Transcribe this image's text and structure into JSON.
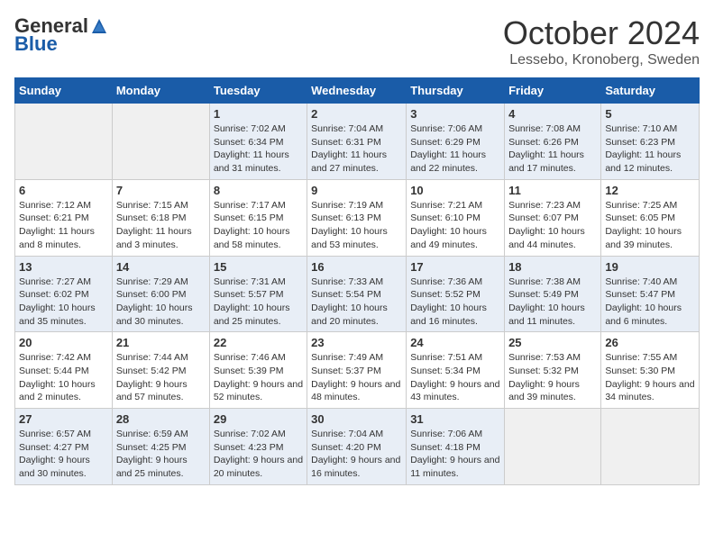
{
  "header": {
    "logo_general": "General",
    "logo_blue": "Blue",
    "month_title": "October 2024",
    "location": "Lessebo, Kronoberg, Sweden"
  },
  "weekdays": [
    "Sunday",
    "Monday",
    "Tuesday",
    "Wednesday",
    "Thursday",
    "Friday",
    "Saturday"
  ],
  "weeks": [
    [
      {
        "day": "",
        "sunrise": "",
        "sunset": "",
        "daylight": ""
      },
      {
        "day": "",
        "sunrise": "",
        "sunset": "",
        "daylight": ""
      },
      {
        "day": "1",
        "sunrise": "Sunrise: 7:02 AM",
        "sunset": "Sunset: 6:34 PM",
        "daylight": "Daylight: 11 hours and 31 minutes."
      },
      {
        "day": "2",
        "sunrise": "Sunrise: 7:04 AM",
        "sunset": "Sunset: 6:31 PM",
        "daylight": "Daylight: 11 hours and 27 minutes."
      },
      {
        "day": "3",
        "sunrise": "Sunrise: 7:06 AM",
        "sunset": "Sunset: 6:29 PM",
        "daylight": "Daylight: 11 hours and 22 minutes."
      },
      {
        "day": "4",
        "sunrise": "Sunrise: 7:08 AM",
        "sunset": "Sunset: 6:26 PM",
        "daylight": "Daylight: 11 hours and 17 minutes."
      },
      {
        "day": "5",
        "sunrise": "Sunrise: 7:10 AM",
        "sunset": "Sunset: 6:23 PM",
        "daylight": "Daylight: 11 hours and 12 minutes."
      }
    ],
    [
      {
        "day": "6",
        "sunrise": "Sunrise: 7:12 AM",
        "sunset": "Sunset: 6:21 PM",
        "daylight": "Daylight: 11 hours and 8 minutes."
      },
      {
        "day": "7",
        "sunrise": "Sunrise: 7:15 AM",
        "sunset": "Sunset: 6:18 PM",
        "daylight": "Daylight: 11 hours and 3 minutes."
      },
      {
        "day": "8",
        "sunrise": "Sunrise: 7:17 AM",
        "sunset": "Sunset: 6:15 PM",
        "daylight": "Daylight: 10 hours and 58 minutes."
      },
      {
        "day": "9",
        "sunrise": "Sunrise: 7:19 AM",
        "sunset": "Sunset: 6:13 PM",
        "daylight": "Daylight: 10 hours and 53 minutes."
      },
      {
        "day": "10",
        "sunrise": "Sunrise: 7:21 AM",
        "sunset": "Sunset: 6:10 PM",
        "daylight": "Daylight: 10 hours and 49 minutes."
      },
      {
        "day": "11",
        "sunrise": "Sunrise: 7:23 AM",
        "sunset": "Sunset: 6:07 PM",
        "daylight": "Daylight: 10 hours and 44 minutes."
      },
      {
        "day": "12",
        "sunrise": "Sunrise: 7:25 AM",
        "sunset": "Sunset: 6:05 PM",
        "daylight": "Daylight: 10 hours and 39 minutes."
      }
    ],
    [
      {
        "day": "13",
        "sunrise": "Sunrise: 7:27 AM",
        "sunset": "Sunset: 6:02 PM",
        "daylight": "Daylight: 10 hours and 35 minutes."
      },
      {
        "day": "14",
        "sunrise": "Sunrise: 7:29 AM",
        "sunset": "Sunset: 6:00 PM",
        "daylight": "Daylight: 10 hours and 30 minutes."
      },
      {
        "day": "15",
        "sunrise": "Sunrise: 7:31 AM",
        "sunset": "Sunset: 5:57 PM",
        "daylight": "Daylight: 10 hours and 25 minutes."
      },
      {
        "day": "16",
        "sunrise": "Sunrise: 7:33 AM",
        "sunset": "Sunset: 5:54 PM",
        "daylight": "Daylight: 10 hours and 20 minutes."
      },
      {
        "day": "17",
        "sunrise": "Sunrise: 7:36 AM",
        "sunset": "Sunset: 5:52 PM",
        "daylight": "Daylight: 10 hours and 16 minutes."
      },
      {
        "day": "18",
        "sunrise": "Sunrise: 7:38 AM",
        "sunset": "Sunset: 5:49 PM",
        "daylight": "Daylight: 10 hours and 11 minutes."
      },
      {
        "day": "19",
        "sunrise": "Sunrise: 7:40 AM",
        "sunset": "Sunset: 5:47 PM",
        "daylight": "Daylight: 10 hours and 6 minutes."
      }
    ],
    [
      {
        "day": "20",
        "sunrise": "Sunrise: 7:42 AM",
        "sunset": "Sunset: 5:44 PM",
        "daylight": "Daylight: 10 hours and 2 minutes."
      },
      {
        "day": "21",
        "sunrise": "Sunrise: 7:44 AM",
        "sunset": "Sunset: 5:42 PM",
        "daylight": "Daylight: 9 hours and 57 minutes."
      },
      {
        "day": "22",
        "sunrise": "Sunrise: 7:46 AM",
        "sunset": "Sunset: 5:39 PM",
        "daylight": "Daylight: 9 hours and 52 minutes."
      },
      {
        "day": "23",
        "sunrise": "Sunrise: 7:49 AM",
        "sunset": "Sunset: 5:37 PM",
        "daylight": "Daylight: 9 hours and 48 minutes."
      },
      {
        "day": "24",
        "sunrise": "Sunrise: 7:51 AM",
        "sunset": "Sunset: 5:34 PM",
        "daylight": "Daylight: 9 hours and 43 minutes."
      },
      {
        "day": "25",
        "sunrise": "Sunrise: 7:53 AM",
        "sunset": "Sunset: 5:32 PM",
        "daylight": "Daylight: 9 hours and 39 minutes."
      },
      {
        "day": "26",
        "sunrise": "Sunrise: 7:55 AM",
        "sunset": "Sunset: 5:30 PM",
        "daylight": "Daylight: 9 hours and 34 minutes."
      }
    ],
    [
      {
        "day": "27",
        "sunrise": "Sunrise: 6:57 AM",
        "sunset": "Sunset: 4:27 PM",
        "daylight": "Daylight: 9 hours and 30 minutes."
      },
      {
        "day": "28",
        "sunrise": "Sunrise: 6:59 AM",
        "sunset": "Sunset: 4:25 PM",
        "daylight": "Daylight: 9 hours and 25 minutes."
      },
      {
        "day": "29",
        "sunrise": "Sunrise: 7:02 AM",
        "sunset": "Sunset: 4:23 PM",
        "daylight": "Daylight: 9 hours and 20 minutes."
      },
      {
        "day": "30",
        "sunrise": "Sunrise: 7:04 AM",
        "sunset": "Sunset: 4:20 PM",
        "daylight": "Daylight: 9 hours and 16 minutes."
      },
      {
        "day": "31",
        "sunrise": "Sunrise: 7:06 AM",
        "sunset": "Sunset: 4:18 PM",
        "daylight": "Daylight: 9 hours and 11 minutes."
      },
      {
        "day": "",
        "sunrise": "",
        "sunset": "",
        "daylight": ""
      },
      {
        "day": "",
        "sunrise": "",
        "sunset": "",
        "daylight": ""
      }
    ]
  ]
}
